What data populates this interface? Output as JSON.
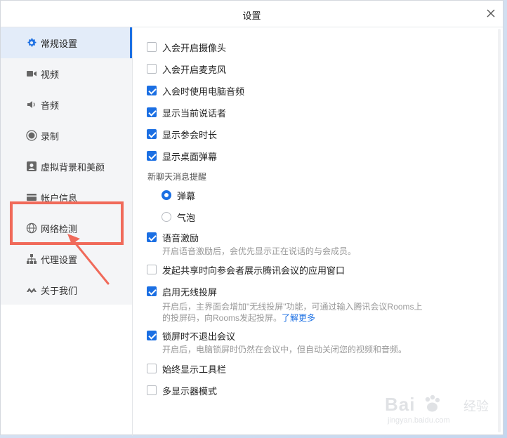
{
  "window": {
    "title": "设置"
  },
  "sidebar": {
    "items": [
      {
        "label": "常规设置",
        "icon": "gear-icon",
        "active": true
      },
      {
        "label": "视频",
        "icon": "video-icon",
        "active": false
      },
      {
        "label": "音频",
        "icon": "speaker-icon",
        "active": false
      },
      {
        "label": "录制",
        "icon": "record-icon",
        "active": false
      },
      {
        "label": "虚拟背景和美颜",
        "icon": "portrait-icon",
        "active": false
      },
      {
        "label": "帐户信息",
        "icon": "card-icon",
        "active": false
      },
      {
        "label": "网络检测",
        "icon": "globe-icon",
        "active": false
      },
      {
        "label": "代理设置",
        "icon": "network-icon",
        "active": false
      },
      {
        "label": "关于我们",
        "icon": "logo-icon",
        "active": false
      }
    ]
  },
  "settings": {
    "camera_on_join": {
      "label": "入会开启摄像头",
      "checked": false
    },
    "mic_on_join": {
      "label": "入会开启麦克风",
      "checked": false
    },
    "computer_audio": {
      "label": "入会时使用电脑音频",
      "checked": true
    },
    "show_speaker": {
      "label": "显示当前说话者",
      "checked": true
    },
    "show_duration": {
      "label": "显示参会时长",
      "checked": true
    },
    "desktop_barrage": {
      "label": "显示桌面弹幕",
      "checked": true
    },
    "chat_alert": {
      "section_label": "新聊天消息提醒",
      "options": [
        {
          "label": "弹幕",
          "selected": true
        },
        {
          "label": "气泡",
          "selected": false
        }
      ]
    },
    "voice_excite": {
      "label": "语音激励",
      "checked": true,
      "description": "开启语音激励后，会优先显示正在说话的与会成员。"
    },
    "share_app_window": {
      "label": "发起共享时向参会者展示腾讯会议的应用窗口",
      "checked": false
    },
    "wireless_cast": {
      "label": "启用无线投屏",
      "checked": true,
      "description_line1": "开启后，主界面会增加\"无线投屏\"功能，可通过输入腾讯会议Rooms上",
      "description_line2": "的投屏码，向Rooms发起投屏。",
      "link": "了解更多"
    },
    "lock_screen": {
      "label": "锁屏时不退出会议",
      "checked": true,
      "description": "开启后，电脑锁屏时仍然在会议中，但自动关闭您的视频和音频。"
    },
    "always_toolbar": {
      "label": "始终显示工具栏",
      "checked": false
    },
    "multi_monitor": {
      "label": "多显示器模式",
      "checked": false
    }
  },
  "watermark": {
    "brand": "Bai",
    "text": "经验",
    "sub": "jingyan.baidu.com"
  },
  "colors": {
    "accent": "#1b6fe3",
    "highlight": "#f06a5a"
  }
}
